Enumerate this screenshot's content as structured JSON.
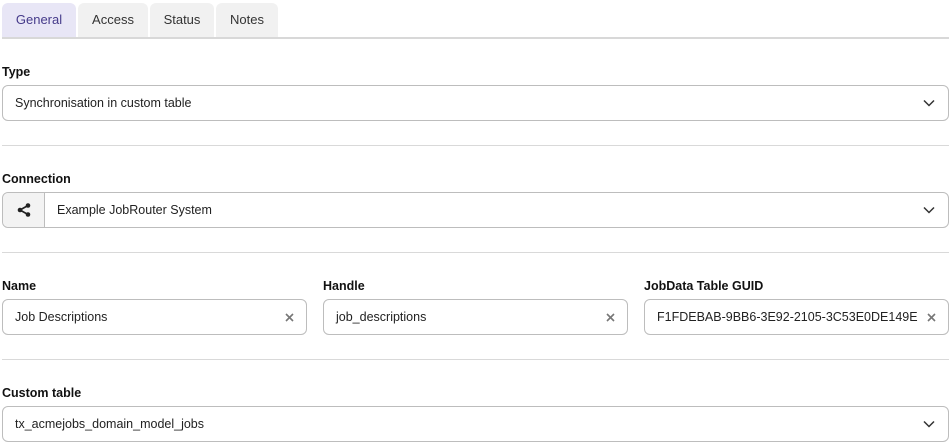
{
  "tabs": [
    {
      "label": "General",
      "active": true
    },
    {
      "label": "Access",
      "active": false
    },
    {
      "label": "Status",
      "active": false
    },
    {
      "label": "Notes",
      "active": false
    }
  ],
  "type": {
    "label": "Type",
    "value": "Synchronisation in custom table"
  },
  "connection": {
    "label": "Connection",
    "value": "Example JobRouter System",
    "icon": "share-nodes-icon"
  },
  "name": {
    "label": "Name",
    "value": "Job Descriptions"
  },
  "handle": {
    "label": "Handle",
    "value": "job_descriptions"
  },
  "guid": {
    "label": "JobData Table GUID",
    "value": "F1FDEBAB-9BB6-3E92-2105-3C53E0DE149E"
  },
  "custom_table": {
    "label": "Custom table",
    "value": "tx_acmejobs_domain_model_jobs"
  },
  "colors": {
    "accent": "#4f43a1",
    "active_tab_bg": "#e8e6f6",
    "border": "#bdbdbd"
  }
}
